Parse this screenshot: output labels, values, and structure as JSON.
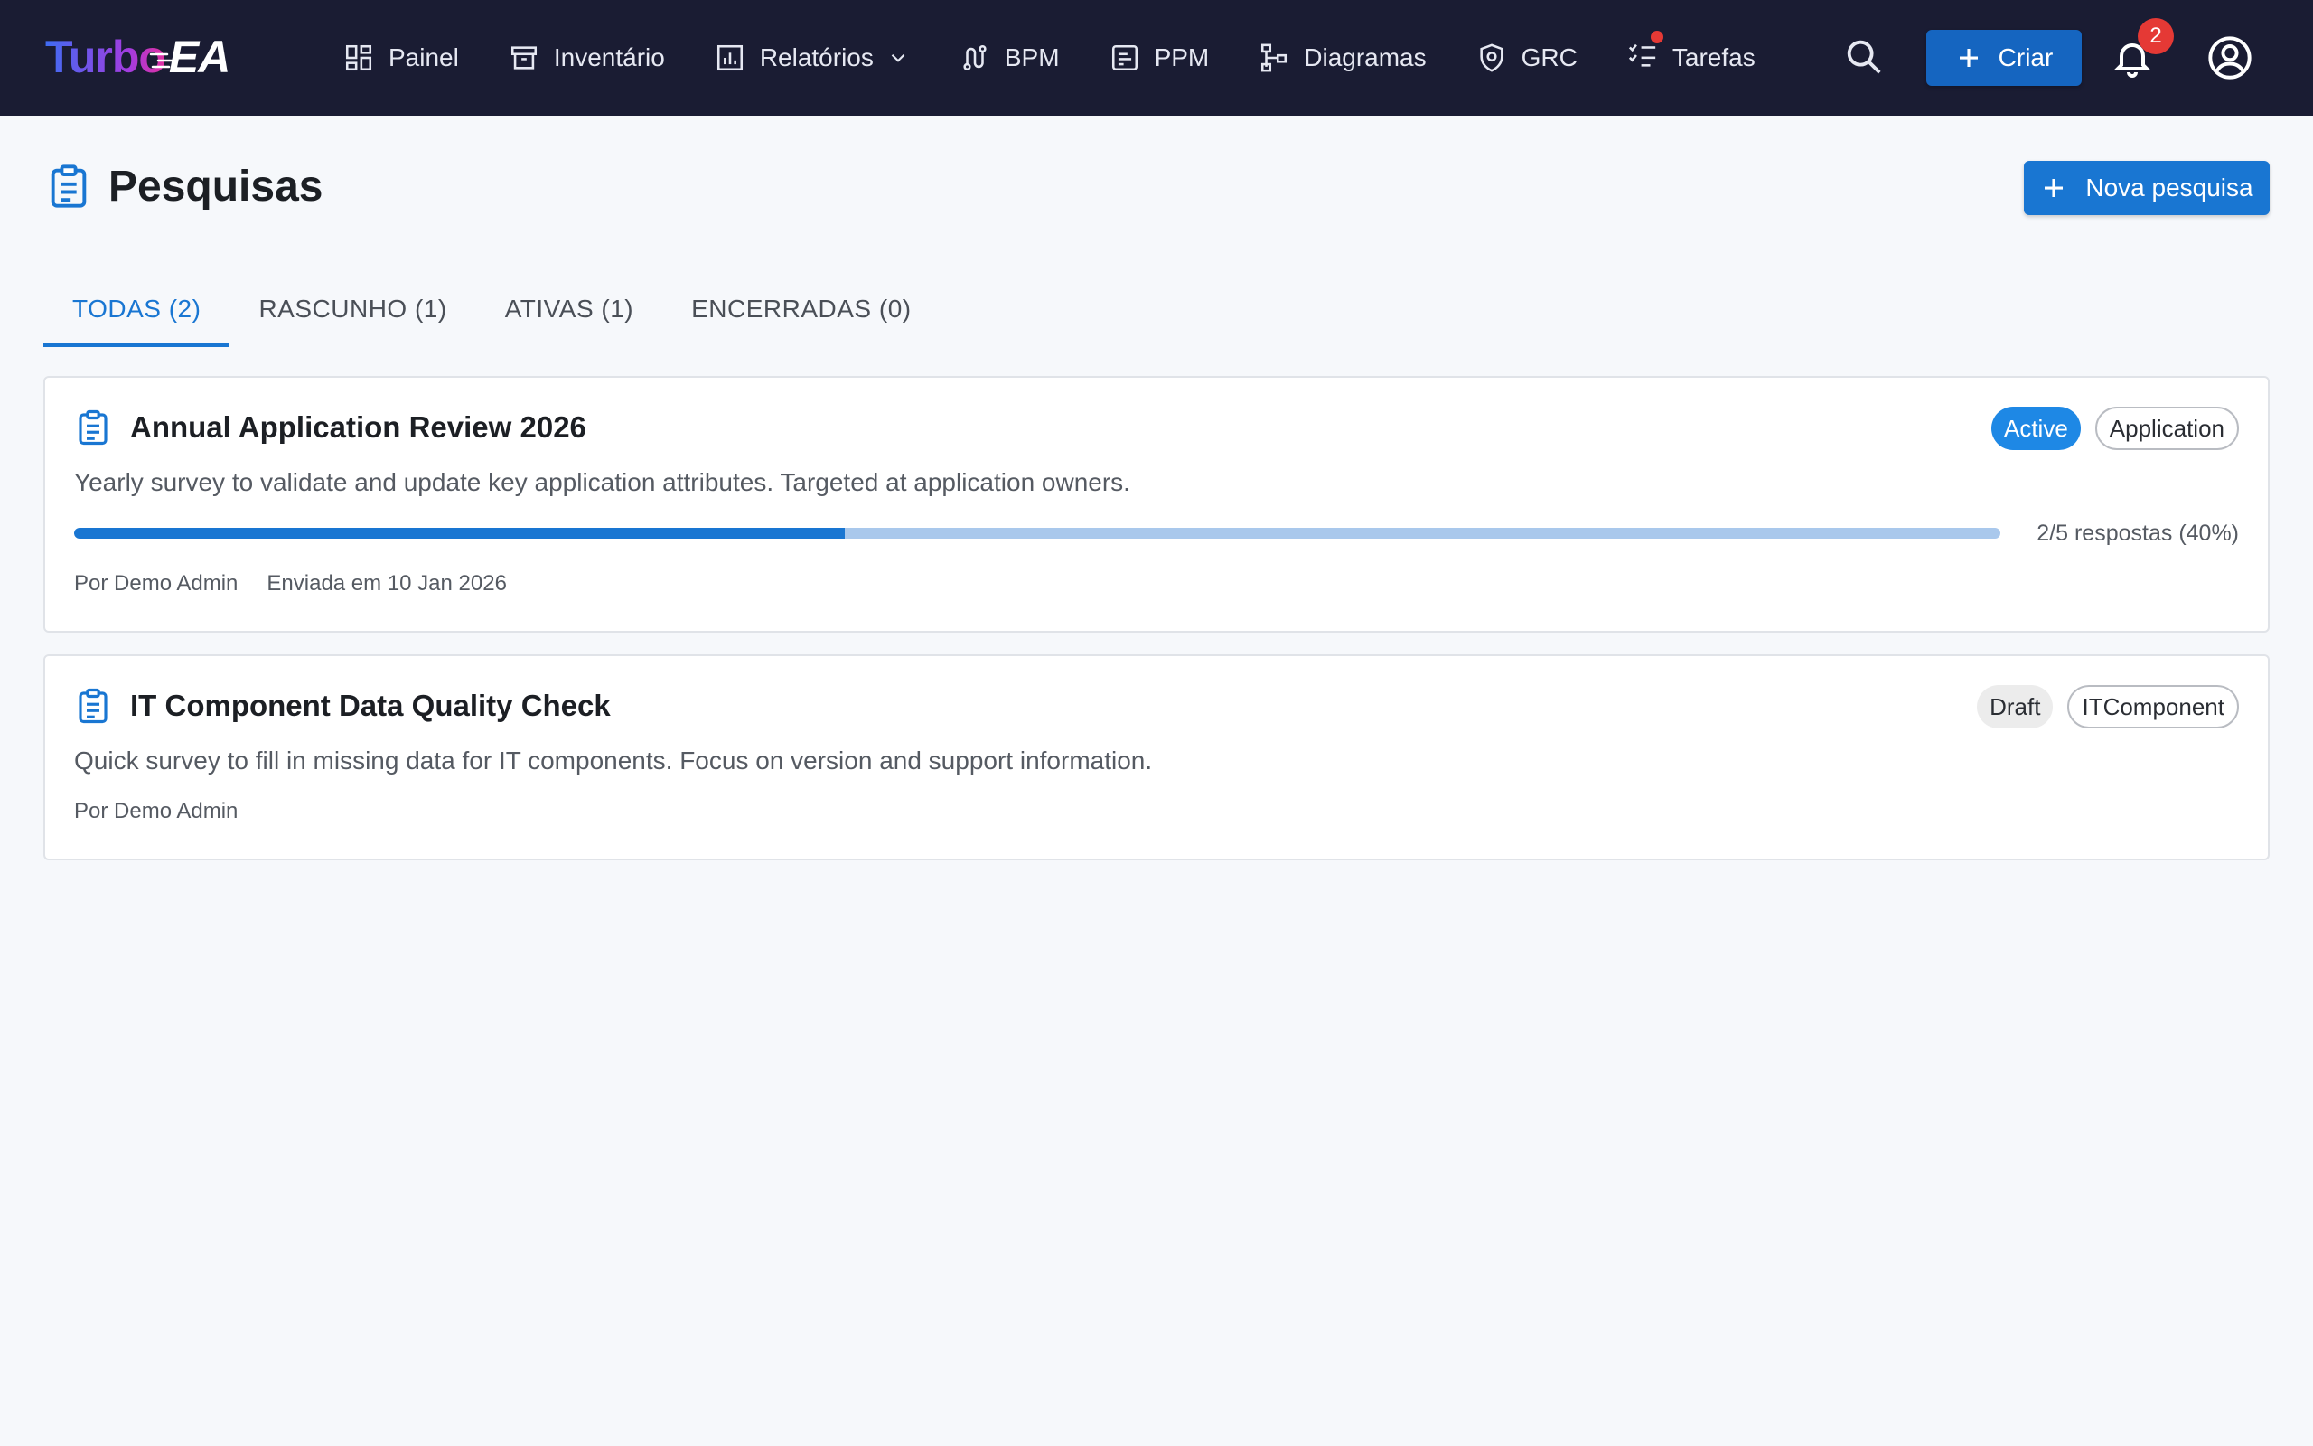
{
  "app": {
    "logo_turbo": "Turbo",
    "logo_ea": "EA"
  },
  "nav": {
    "items": [
      {
        "label": "Painel",
        "icon": "dashboard-icon"
      },
      {
        "label": "Inventário",
        "icon": "archive-icon"
      },
      {
        "label": "Relatórios",
        "icon": "bar-chart-icon",
        "has_dropdown": true
      },
      {
        "label": "BPM",
        "icon": "route-icon"
      },
      {
        "label": "PPM",
        "icon": "project-icon"
      },
      {
        "label": "Diagramas",
        "icon": "diagram-icon"
      },
      {
        "label": "GRC",
        "icon": "shield-icon"
      },
      {
        "label": "Tarefas",
        "icon": "checklist-icon",
        "has_dot": true
      }
    ],
    "create_label": "Criar",
    "notifications_count": "2"
  },
  "page": {
    "title": "Pesquisas",
    "new_button_label": "Nova pesquisa"
  },
  "tabs": [
    {
      "label": "TODAS (2)",
      "active": true
    },
    {
      "label": "RASCUNHO (1)",
      "active": false
    },
    {
      "label": "ATIVAS (1)",
      "active": false
    },
    {
      "label": "ENCERRADAS (0)",
      "active": false
    }
  ],
  "surveys": [
    {
      "title": "Annual Application Review 2026",
      "description": "Yearly survey to validate and update key application attributes. Targeted at application owners.",
      "status": "Active",
      "type": "Application",
      "progress_fraction": 0.4,
      "progress_text": "2/5 respostas (40%)",
      "author": "Por Demo Admin",
      "sent": "Enviada em 10 Jan 2026"
    },
    {
      "title": "IT Component Data Quality Check",
      "description": "Quick survey to fill in missing data for IT components. Focus on version and support information.",
      "status": "Draft",
      "type": "ITComponent",
      "author": "Por Demo Admin"
    }
  ],
  "colors": {
    "topbar": "#1a1c33",
    "primary": "#1976d2",
    "badge_red": "#e53935"
  }
}
